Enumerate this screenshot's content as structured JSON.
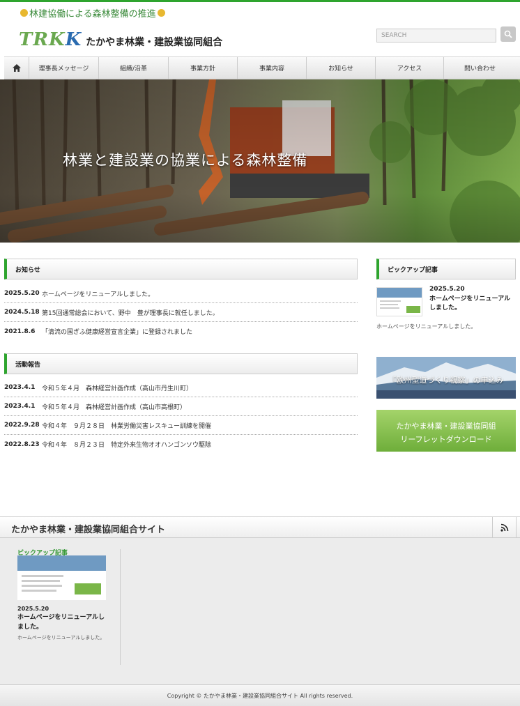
{
  "header": {
    "tagline": "林建協働による森林整備の推進",
    "logo_mark_a": "TRK",
    "logo_mark_b": "K",
    "org_name": "たかやま林業・建設業協同組合",
    "search_placeholder": "SEARCH"
  },
  "nav": {
    "items": [
      "理事長メッセージ",
      "組織/沿革",
      "事業方針",
      "事業内容",
      "お知らせ",
      "アクセス",
      "問い合わせ"
    ]
  },
  "hero": {
    "caption": "林業と建設業の協業による森林整備"
  },
  "news": {
    "heading": "お知らせ",
    "items": [
      {
        "date": "2025.5.20",
        "text": "ホームページをリニューアルしました。"
      },
      {
        "date": "2024.5.18",
        "text": "第15回通常総会において、野中　豊が理事長に就任しました。"
      },
      {
        "date": "2021.8.6",
        "text": "「清流の国ぎふ健康経営宣言企業」に登録されました"
      }
    ]
  },
  "activity": {
    "heading": "活動報告",
    "items": [
      {
        "date": "2023.4.1",
        "text": "令和５年４月　森林経営計画作成（高山市丹生川町）"
      },
      {
        "date": "2023.4.1",
        "text": "令和５年４月　森林経営計画作成（高山市高根町）"
      },
      {
        "date": "2022.9.28",
        "text": "令和４年　９月２８日　林業労働災害レスキュー訓練を開催"
      },
      {
        "date": "2022.8.23",
        "text": "令和４年　８月２３日　特定外来生物オオハンゴンソウ駆除"
      }
    ]
  },
  "sidebar": {
    "pickup_heading": "ピックアップ記事",
    "pickup_date": "2025.5.20",
    "pickup_title": "ホームページをリニューアルしました。",
    "pickup_desc": "ホームページをリニューアルしました。",
    "banner1": "「欧州型道づくり視察」の申込み",
    "banner2_line1": "たかやま林業・建設業協同組",
    "banner2_line2": "リーフレットダウンロード"
  },
  "footer": {
    "site_title": "たかやま林業・建設業協同組合サイト",
    "widget_heading": "ピックアップ記事",
    "widget_date": "2025.5.20",
    "widget_title": "ホームページをリニューアルしました。",
    "widget_desc": "ホームページをリニューアルしました。",
    "copyright": "Copyright ©  たかやま林業・建設業協同組合サイト All rights reserved."
  },
  "colors": {
    "accent": "#2ea42e",
    "tagline_dot": "#e8b830",
    "logo_green": "#6aa84f",
    "logo_blue": "#2a6bb0"
  },
  "icons": {
    "home": "home-icon",
    "search": "search-icon",
    "rss": "rss-icon"
  }
}
